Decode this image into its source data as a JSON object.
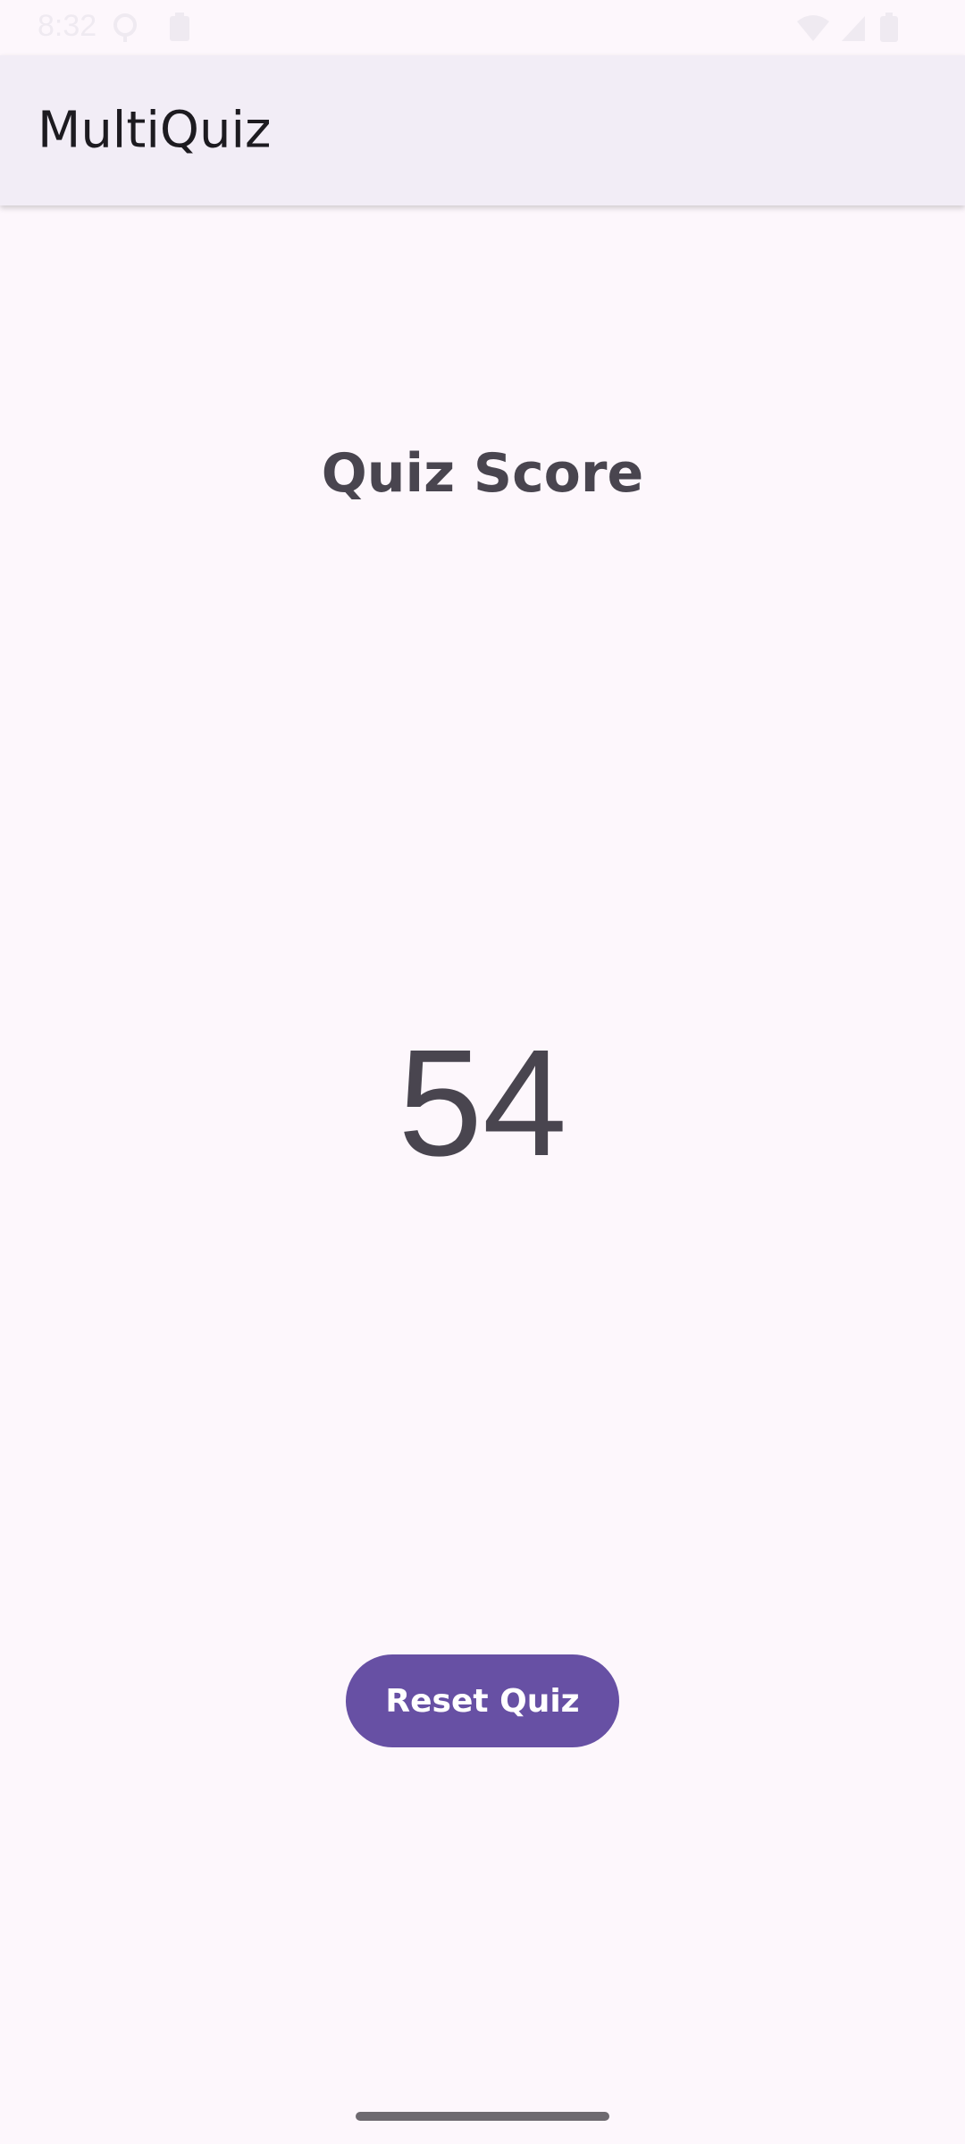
{
  "status_bar": {
    "time": "8:32",
    "icons": [
      "location-icon",
      "battery-saver-icon",
      "wifi-icon",
      "cellular-icon",
      "battery-icon"
    ]
  },
  "app_bar": {
    "title": "MultiQuiz"
  },
  "main": {
    "heading": "Quiz Score",
    "score": "54",
    "reset_label": "Reset Quiz"
  },
  "colors": {
    "primary": "#6750A4",
    "background": "#FDF7FC",
    "app_bar": "#F2EDF6",
    "text": "#49454F"
  }
}
